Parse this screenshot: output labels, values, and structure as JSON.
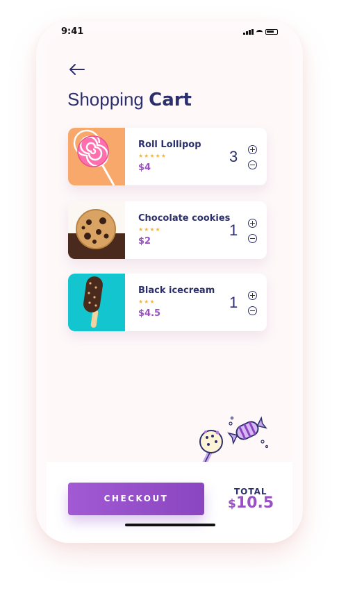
{
  "status": {
    "time": "9:41"
  },
  "header": {
    "title_light": "Shopping ",
    "title_bold": "Cart"
  },
  "cart_items": [
    {
      "name": "Roll Lollipop",
      "stars": "★★★★★",
      "price": "$4",
      "quantity": "3"
    },
    {
      "name": "Chocolate cookies",
      "stars": "★★★★",
      "price": "$2",
      "quantity": "1"
    },
    {
      "name": "Black icecream",
      "stars": "★★★",
      "price": "$4.5",
      "quantity": "1"
    }
  ],
  "footer": {
    "checkout_label": "CHECKOUT",
    "total_label": "TOTAL",
    "total_currency": "$",
    "total_amount": "10.5"
  },
  "colors": {
    "accent": "#9b4fc7",
    "navy": "#2b2f6b",
    "star": "#f4b63a"
  },
  "icons": [
    "back-arrow-icon",
    "plus-circle-icon",
    "minus-circle-icon",
    "candy-illustration"
  ]
}
